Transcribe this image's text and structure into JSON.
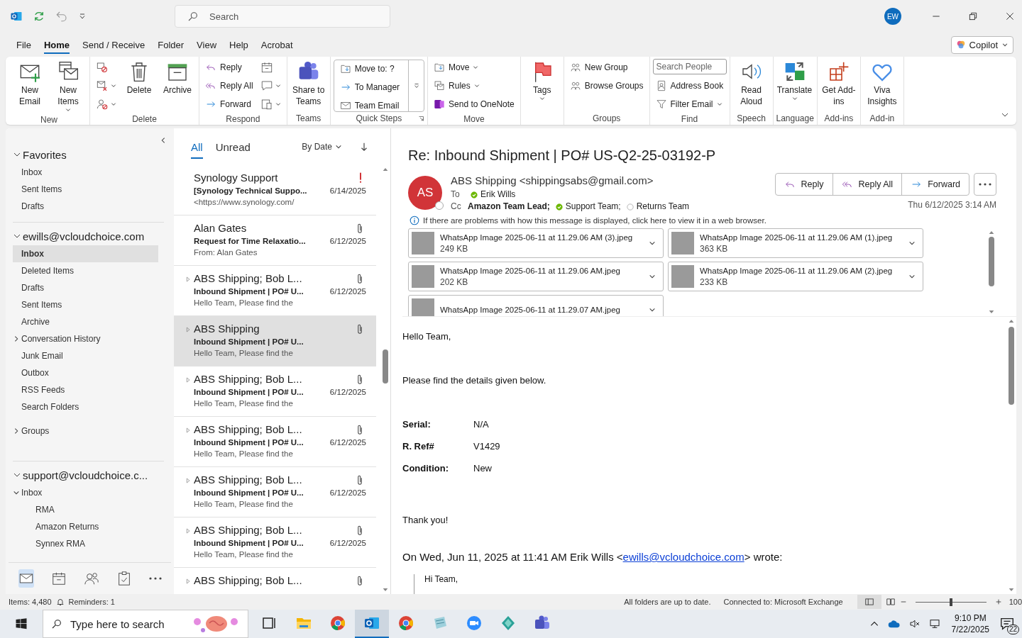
{
  "title_bar": {
    "search": {
      "placeholder": "Search"
    },
    "avatar": "EW"
  },
  "menu_tabs": [
    {
      "label": "File",
      "selected": false
    },
    {
      "label": "Home",
      "selected": true
    },
    {
      "label": "Send / Receive",
      "selected": false
    },
    {
      "label": "Folder",
      "selected": false
    },
    {
      "label": "View",
      "selected": false
    },
    {
      "label": "Help",
      "selected": false
    },
    {
      "label": "Acrobat",
      "selected": false
    }
  ],
  "copilot": {
    "label": "Copilot"
  },
  "ribbon": [
    {
      "label": "New",
      "columns": [
        [
          {
            "kind": "large",
            "label": "New Email"
          }
        ],
        [
          {
            "kind": "large",
            "label": "New Items",
            "menu": true
          }
        ]
      ]
    },
    {
      "label": "Delete",
      "columns": [
        [
          {
            "kind": "icon"
          },
          {
            "kind": "icon",
            "menu": true
          },
          {
            "kind": "icon",
            "menu": true
          }
        ],
        [
          {
            "kind": "large",
            "label": "Delete"
          }
        ],
        [
          {
            "kind": "large",
            "label": "Archive"
          }
        ]
      ]
    },
    {
      "label": "Respond",
      "columns": [
        [
          {
            "kind": "small",
            "label": "Reply"
          },
          {
            "kind": "small",
            "label": "Reply All"
          },
          {
            "kind": "small",
            "label": "Forward"
          }
        ],
        [
          {
            "kind": "icon"
          },
          {
            "kind": "icon",
            "menu": true
          },
          {
            "kind": "icon",
            "menu": true
          }
        ]
      ]
    },
    {
      "label": "Teams",
      "columns": [
        [
          {
            "kind": "large",
            "label": "Share to Teams"
          }
        ]
      ]
    },
    {
      "label": "Quick Steps",
      "kind": "gallery",
      "launcher": true,
      "columns": [
        [
          {
            "kind": "small",
            "label": "Move to: ?"
          },
          {
            "kind": "small",
            "label": "To Manager"
          },
          {
            "kind": "small",
            "label": "Team Email"
          }
        ]
      ]
    },
    {
      "label": "Move",
      "columns": [
        [
          {
            "kind": "small",
            "label": "Move",
            "menu": true
          },
          {
            "kind": "small",
            "label": "Rules",
            "menu": true
          },
          {
            "kind": "small",
            "label": "Send to OneNote"
          }
        ]
      ]
    },
    {
      "columns": [
        [
          {
            "kind": "large",
            "label": "Tags",
            "menu": true
          }
        ]
      ]
    },
    {
      "label": "Groups",
      "columns": [
        [
          {
            "kind": "small",
            "label": "New Group"
          },
          {
            "kind": "small",
            "label": "Browse Groups"
          }
        ]
      ]
    },
    {
      "label": "Find",
      "columns": [
        [
          {
            "kind": "field",
            "placeholder": "Search People"
          },
          {
            "kind": "small",
            "label": "Address Book"
          },
          {
            "kind": "small",
            "label": "Filter Email",
            "menu": true
          }
        ]
      ]
    },
    {
      "label": "Speech",
      "columns": [
        [
          {
            "kind": "large",
            "label": "Read Aloud"
          }
        ]
      ]
    },
    {
      "label": "Language",
      "columns": [
        [
          {
            "kind": "large",
            "label": "Translate",
            "menu": true
          }
        ]
      ]
    },
    {
      "label": "Add-ins",
      "columns": [
        [
          {
            "kind": "large",
            "label": "Get Add-ins"
          }
        ]
      ]
    },
    {
      "label": "Add-in",
      "columns": [
        [
          {
            "kind": "large",
            "label": "Viva Insights"
          }
        ]
      ]
    }
  ],
  "folder_pane": {
    "sections": [
      {
        "label": "Favorites",
        "expanded": true,
        "folders": [
          {
            "label": "Inbox",
            "selected": false
          },
          {
            "label": "Sent Items",
            "selected": false
          },
          {
            "label": "Drafts",
            "selected": false
          }
        ]
      },
      {
        "label": "ewills@vcloudchoice.com",
        "expanded": true,
        "folders": [
          {
            "label": "Inbox",
            "selected": true
          },
          {
            "label": "Deleted Items",
            "selected": false
          },
          {
            "label": "Drafts",
            "selected": false
          },
          {
            "label": "Sent Items",
            "selected": false
          },
          {
            "label": "Archive",
            "selected": false
          },
          {
            "label": "Conversation History",
            "selected": false,
            "expanded": false
          },
          {
            "label": "Junk Email",
            "selected": false
          },
          {
            "label": "Outbox",
            "selected": false
          },
          {
            "label": "RSS Feeds",
            "selected": false
          },
          {
            "label": "Search Folders",
            "selected": false
          }
        ],
        "extra": [
          {
            "label": "Groups",
            "expanded": false
          }
        ]
      },
      {
        "label": "support@vcloudchoice.c...",
        "expanded": true,
        "folders": [
          {
            "label": "Inbox",
            "selected": false,
            "expanded": true,
            "children": [
              {
                "label": "RMA",
                "selected": false
              },
              {
                "label": "Amazon Returns",
                "selected": false
              },
              {
                "label": "Synnex RMA",
                "selected": false
              }
            ]
          }
        ]
      }
    ],
    "nav": [
      {
        "kind": "mail",
        "selected": true
      },
      {
        "kind": "calendar",
        "selected": false
      },
      {
        "kind": "people",
        "selected": false
      },
      {
        "kind": "tasks",
        "selected": false
      },
      {
        "kind": "more",
        "selected": false
      }
    ]
  },
  "message_list": {
    "tabs": [
      {
        "label": "All",
        "selected": true
      },
      {
        "label": "Unread",
        "selected": false
      }
    ],
    "sort": "By Date",
    "messages": [
      {
        "sender": "Synology Support",
        "subject": "[Synology Technical Suppo...",
        "preview": "<https://www.synology.com/",
        "date": "6/14/2025",
        "important": true,
        "attachment": false,
        "thread": false,
        "selected": false
      },
      {
        "sender": "Alan Gates",
        "subject": "Request for Time Relaxatio...",
        "preview": "From: Alan Gates",
        "date": "6/12/2025",
        "important": false,
        "attachment": true,
        "thread": false,
        "selected": false
      },
      {
        "sender": "ABS Shipping;  Bob L...",
        "subject": "Inbound Shipment | PO# U...",
        "preview": "Hello Team,  Please find the",
        "date": "6/12/2025",
        "important": false,
        "attachment": true,
        "thread": true,
        "selected": false
      },
      {
        "sender": "ABS Shipping",
        "subject": "Inbound Shipment | PO# U...",
        "preview": "Hello Team,  Please find the",
        "important": false,
        "attachment": true,
        "thread": true,
        "selected": true
      },
      {
        "sender": "ABS Shipping;  Bob L...",
        "subject": "Inbound Shipment | PO# U...",
        "preview": "Hello Team,  Please find the",
        "date": "6/12/2025",
        "important": false,
        "attachment": true,
        "thread": true,
        "selected": false
      },
      {
        "sender": "ABS Shipping;  Bob L...",
        "subject": "Inbound Shipment | PO# U...",
        "preview": "Hello Team,  Please find the",
        "date": "6/12/2025",
        "important": false,
        "attachment": true,
        "thread": true,
        "selected": false
      },
      {
        "sender": "ABS Shipping;  Bob L...",
        "subject": "Inbound Shipment | PO# U...",
        "preview": "Hello Team,  Please find the",
        "date": "6/12/2025",
        "important": false,
        "attachment": true,
        "thread": true,
        "selected": false
      },
      {
        "sender": "ABS Shipping;  Bob L...",
        "subject": "Inbound Shipment | PO# U...",
        "preview": "Hello Team,  Please find the",
        "date": "6/12/2025",
        "important": false,
        "attachment": true,
        "thread": true,
        "selected": false
      },
      {
        "sender": "ABS Shipping;  Bob L...",
        "important": false,
        "attachment": true,
        "thread": true,
        "selected": false
      }
    ]
  },
  "reading_pane": {
    "subject": "Re: Inbound Shipment | PO# US-Q2-25-03192-P",
    "avatar": "AS",
    "from": "ABS Shipping <shippingsabs@gmail.com>",
    "to_label": "To",
    "to": [
      {
        "name": "Erik Wills",
        "kind": "available",
        "bold": false
      }
    ],
    "cc_label": "Cc",
    "cc": [
      {
        "name": "Amazon Team Lead;",
        "kind": "plain",
        "bold": true
      },
      {
        "name": "Support Team;",
        "kind": "available",
        "bold": false
      },
      {
        "name": "Returns Team",
        "kind": "offline",
        "bold": false
      }
    ],
    "actions": [
      "Reply",
      "Reply All",
      "Forward"
    ],
    "date": "Thu 6/12/2025 3:14 AM",
    "info": "If there are problems with how this message is displayed, click here to view it in a web browser.",
    "attachments": [
      {
        "name": "WhatsApp Image 2025-06-11 at 11.29.06 AM (3).jpeg",
        "size": "249 KB"
      },
      {
        "name": "WhatsApp Image 2025-06-11 at 11.29.06 AM (1).jpeg",
        "size": "363 KB"
      },
      {
        "name": "WhatsApp Image 2025-06-11 at 11.29.06 AM.jpeg",
        "size": "202 KB"
      },
      {
        "name": "WhatsApp Image 2025-06-11 at 11.29.06 AM (2).jpeg",
        "size": "233 KB"
      },
      {
        "name": "WhatsApp Image 2025-06-11 at 11.29.07 AM.jpeg"
      }
    ],
    "body": [
      {
        "kind": "para",
        "text": "Hello Team,"
      },
      {
        "kind": "para",
        "text": "Please find the details given below."
      },
      {
        "kind": "field",
        "label": "Serial:",
        "value": "N/A"
      },
      {
        "kind": "field",
        "label": "R. Ref#",
        "value": "V1429"
      },
      {
        "kind": "field",
        "label": "Condition:",
        "value": "New"
      },
      {
        "kind": "para",
        "text": "Thank you!"
      },
      {
        "kind": "quote_header",
        "before": "On Wed, Jun 11, 2025 at 11:41 AM Erik Wills <",
        "link": "ewills@vcloudchoice.com",
        "after": "> wrote:"
      },
      {
        "kind": "quote",
        "text": "Hi Team,"
      }
    ]
  },
  "status_bar": {
    "items": "Items: 4,480",
    "reminders": "Reminders: 1",
    "sync": "All folders are up to date.",
    "connection": "Connected to: Microsoft Exchange",
    "zoom": {
      "level": 0.5,
      "reading": "100"
    }
  },
  "taskbar": {
    "search": {
      "placeholder": "Type here to search"
    },
    "apps": [
      {
        "kind": "taskview",
        "selected": false
      },
      {
        "kind": "explorer",
        "selected": false
      },
      {
        "kind": "chrome",
        "selected": false
      },
      {
        "kind": "outlook",
        "selected": true
      },
      {
        "kind": "chrome",
        "selected": false
      },
      {
        "kind": "notes",
        "selected": false
      },
      {
        "kind": "zoom",
        "selected": false
      },
      {
        "kind": "gem",
        "selected": false
      },
      {
        "kind": "teams",
        "selected": false
      }
    ],
    "time": "9:10 PM",
    "date": "7/22/2025",
    "notifications": "22"
  }
}
